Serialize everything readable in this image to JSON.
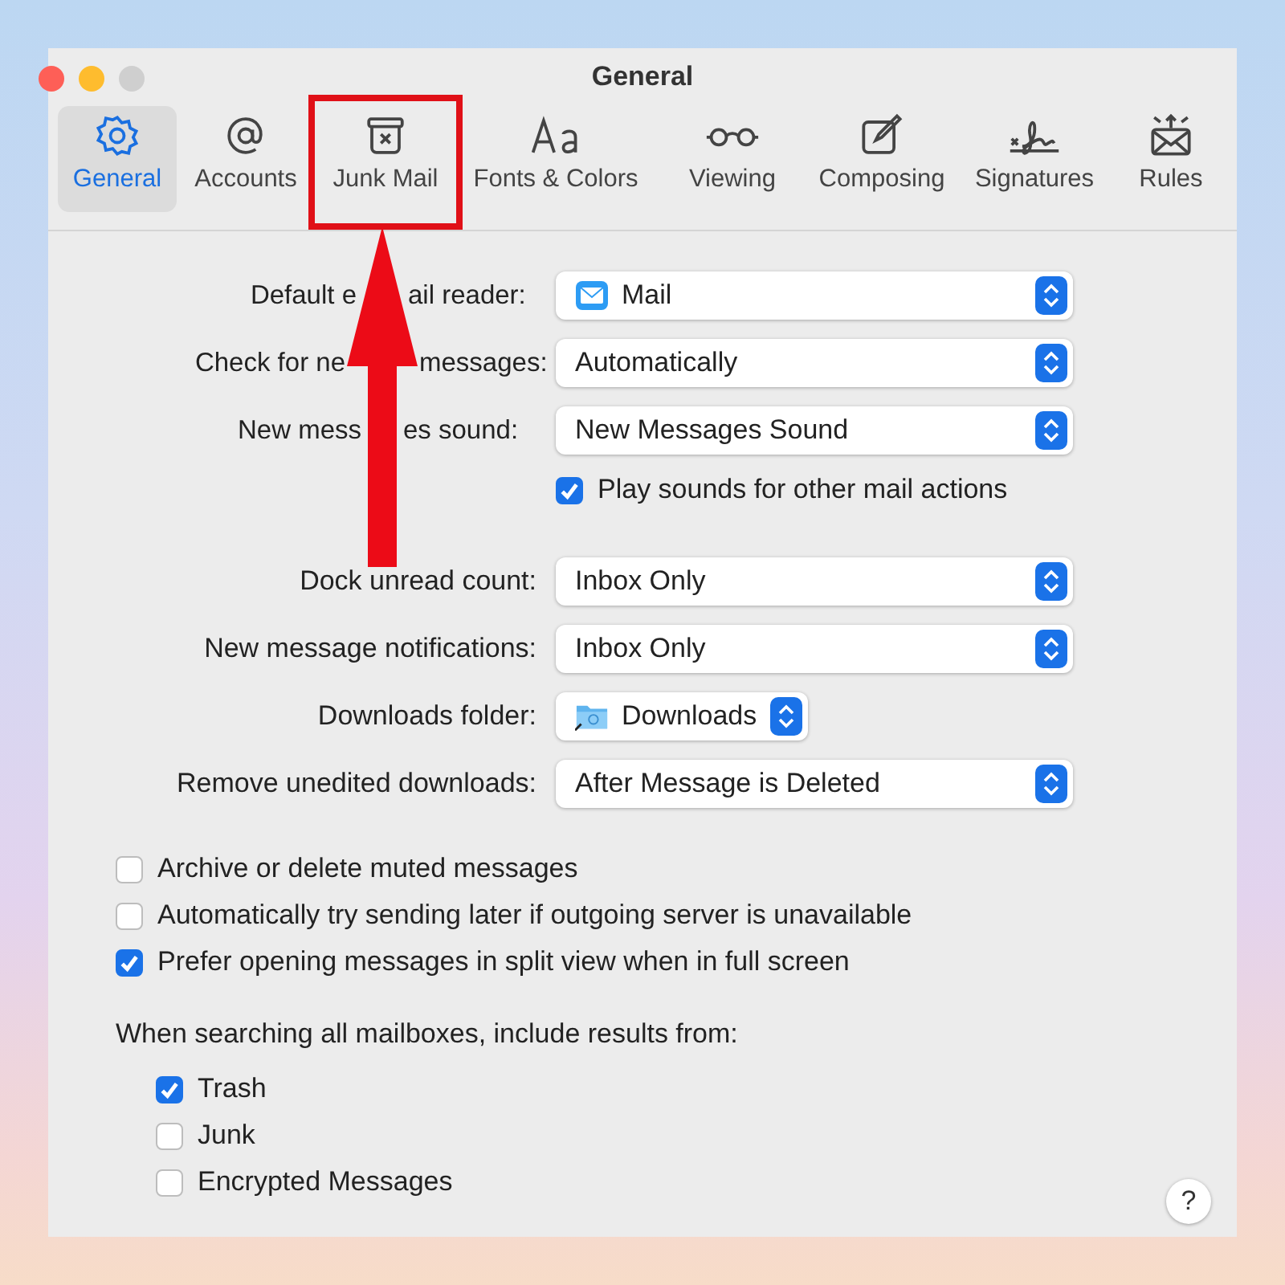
{
  "window": {
    "title": "General"
  },
  "tabs": [
    {
      "label": "General",
      "selected": true,
      "highlighted": false
    },
    {
      "label": "Accounts",
      "selected": false,
      "highlighted": false
    },
    {
      "label": "Junk Mail",
      "selected": false,
      "highlighted": true
    },
    {
      "label": "Fonts & Colors",
      "selected": false,
      "highlighted": false
    },
    {
      "label": "Viewing",
      "selected": false,
      "highlighted": false
    },
    {
      "label": "Composing",
      "selected": false,
      "highlighted": false
    },
    {
      "label": "Signatures",
      "selected": false,
      "highlighted": false
    },
    {
      "label": "Rules",
      "selected": false,
      "highlighted": false
    }
  ],
  "settings": [
    {
      "kind": "app-popup",
      "label_parts": [
        "Default e",
        "ail reader:"
      ],
      "value": "Mail"
    },
    {
      "kind": "popup",
      "label_parts": [
        "Check for ne",
        "messages:"
      ],
      "value": "Automatically"
    },
    {
      "kind": "popup",
      "label_parts": [
        "New mess",
        "es sound:"
      ],
      "value": "New Messages Sound"
    },
    {
      "kind": "checkbox",
      "label": "Play sounds for other mail actions",
      "checked": true
    },
    {
      "kind": "gap"
    },
    {
      "kind": "popup",
      "label": "Dock unread count:",
      "value": "Inbox Only"
    },
    {
      "kind": "popup",
      "label": "New message notifications:",
      "value": "Inbox Only"
    },
    {
      "kind": "folder-popup",
      "label": "Downloads folder:",
      "value": "Downloads"
    },
    {
      "kind": "popup",
      "label": "Remove unedited downloads:",
      "value": "After Message is Deleted"
    }
  ],
  "options": [
    {
      "label": "Archive or delete muted messages",
      "checked": false
    },
    {
      "label": "Automatically try sending later if outgoing server is unavailable",
      "checked": false
    },
    {
      "label": "Prefer opening messages in split view when in full screen",
      "checked": true
    }
  ],
  "search_scope": {
    "heading": "When searching all mailboxes, include results from:",
    "items": [
      {
        "label": "Trash",
        "checked": true
      },
      {
        "label": "Junk",
        "checked": false
      },
      {
        "label": "Encrypted Messages",
        "checked": false
      }
    ]
  },
  "help_button": "?"
}
